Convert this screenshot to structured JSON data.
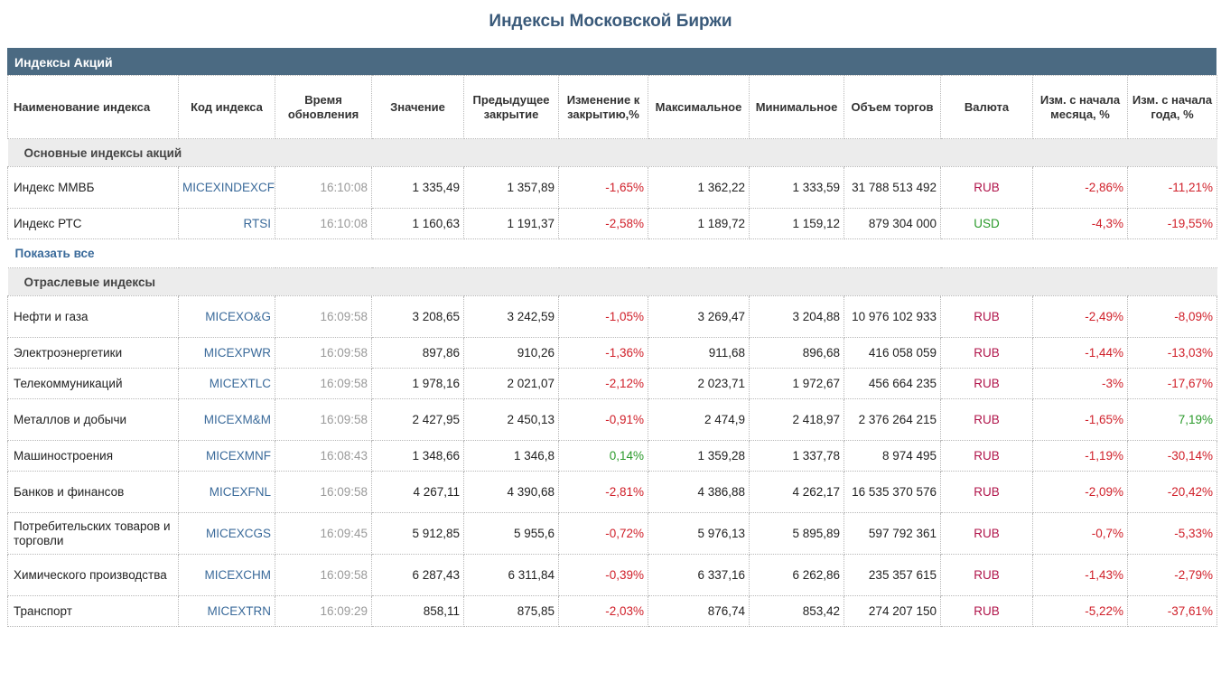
{
  "page_title": "Индексы Московской Биржи",
  "section_title": "Индексы Акций",
  "columns": [
    "Наименование индекса",
    "Код индекса",
    "Время обновления",
    "Значение",
    "Предыдущее закрытие",
    "Изменение к закрытию,%",
    "Максимальное",
    "Минимальное",
    "Объем торгов",
    "Валюта",
    "Изм. с начала месяца, %",
    "Изм. с начала года, %"
  ],
  "groups": [
    {
      "title": "Основные индексы акций",
      "show_all": "Показать все",
      "rows": [
        {
          "name": "Индекс ММВБ",
          "code": "MICEXINDEXCF",
          "time": "16:10:08",
          "value": "1 335,49",
          "prev": "1 357,89",
          "change": "-1,65%",
          "max": "1 362,22",
          "min": "1 333,59",
          "volume": "31 788 513 492",
          "currency": "RUB",
          "month": "-2,86%",
          "year": "-11,21%"
        },
        {
          "name": "Индекс РТС",
          "code": "RTSI",
          "time": "16:10:08",
          "value": "1 160,63",
          "prev": "1 191,37",
          "change": "-2,58%",
          "max": "1 189,72",
          "min": "1 159,12",
          "volume": "879 304 000",
          "currency": "USD",
          "month": "-4,3%",
          "year": "-19,55%"
        }
      ]
    },
    {
      "title": "Отраслевые индексы",
      "rows": [
        {
          "name": "Нефти и газа",
          "code": "MICEXO&G",
          "time": "16:09:58",
          "value": "3 208,65",
          "prev": "3 242,59",
          "change": "-1,05%",
          "max": "3 269,47",
          "min": "3 204,88",
          "volume": "10 976 102 933",
          "currency": "RUB",
          "month": "-2,49%",
          "year": "-8,09%"
        },
        {
          "name": "Электроэнергетики",
          "code": "MICEXPWR",
          "time": "16:09:58",
          "value": "897,86",
          "prev": "910,26",
          "change": "-1,36%",
          "max": "911,68",
          "min": "896,68",
          "volume": "416 058 059",
          "currency": "RUB",
          "month": "-1,44%",
          "year": "-13,03%"
        },
        {
          "name": "Телекоммуникаций",
          "code": "MICEXTLC",
          "time": "16:09:58",
          "value": "1 978,16",
          "prev": "2 021,07",
          "change": "-2,12%",
          "max": "2 023,71",
          "min": "1 972,67",
          "volume": "456 664 235",
          "currency": "RUB",
          "month": "-3%",
          "year": "-17,67%"
        },
        {
          "name": "Металлов и добычи",
          "code": "MICEXM&M",
          "time": "16:09:58",
          "value": "2 427,95",
          "prev": "2 450,13",
          "change": "-0,91%",
          "max": "2 474,9",
          "min": "2 418,97",
          "volume": "2 376 264 215",
          "currency": "RUB",
          "month": "-1,65%",
          "year": "7,19%"
        },
        {
          "name": "Машиностроения",
          "code": "MICEXMNF",
          "time": "16:08:43",
          "value": "1 348,66",
          "prev": "1 346,8",
          "change": "0,14%",
          "max": "1 359,28",
          "min": "1 337,78",
          "volume": "8 974 495",
          "currency": "RUB",
          "month": "-1,19%",
          "year": "-30,14%"
        },
        {
          "name": "Банков и финансов",
          "code": "MICEXFNL",
          "time": "16:09:58",
          "value": "4 267,11",
          "prev": "4 390,68",
          "change": "-2,81%",
          "max": "4 386,88",
          "min": "4 262,17",
          "volume": "16 535 370 576",
          "currency": "RUB",
          "month": "-2,09%",
          "year": "-20,42%"
        },
        {
          "name": "Потребительских товаров и торговли",
          "code": "MICEXCGS",
          "time": "16:09:45",
          "value": "5 912,85",
          "prev": "5 955,6",
          "change": "-0,72%",
          "max": "5 976,13",
          "min": "5 895,89",
          "volume": "597 792 361",
          "currency": "RUB",
          "month": "-0,7%",
          "year": "-5,33%"
        },
        {
          "name": "Химического производства",
          "code": "MICEXCHM",
          "time": "16:09:58",
          "value": "6 287,43",
          "prev": "6 311,84",
          "change": "-0,39%",
          "max": "6 337,16",
          "min": "6 262,86",
          "volume": "235 357 615",
          "currency": "RUB",
          "month": "-1,43%",
          "year": "-2,79%"
        },
        {
          "name": "Транспорт",
          "code": "MICEXTRN",
          "time": "16:09:29",
          "value": "858,11",
          "prev": "875,85",
          "change": "-2,03%",
          "max": "876,74",
          "min": "853,42",
          "volume": "274 207 150",
          "currency": "RUB",
          "month": "-5,22%",
          "year": "-37,61%"
        }
      ]
    }
  ]
}
